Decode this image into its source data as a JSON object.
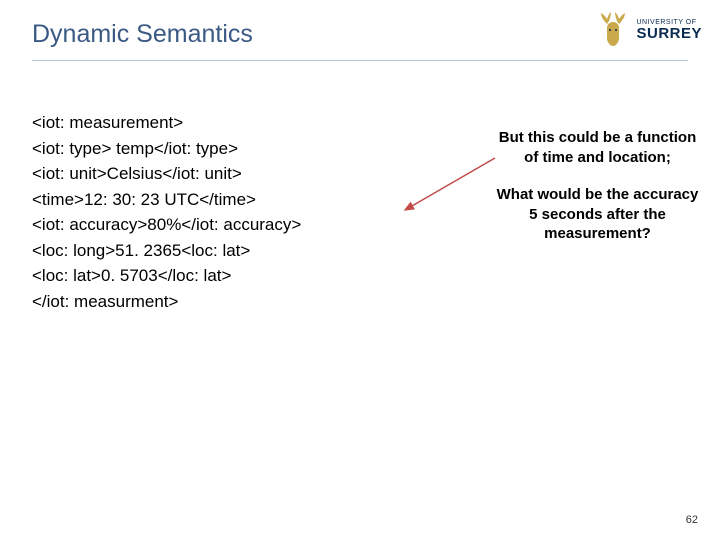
{
  "slide": {
    "title": "Dynamic Semantics",
    "page_number": "62"
  },
  "logo": {
    "university_of": "UNIVERSITY OF",
    "surrey": "SURREY"
  },
  "code": {
    "l1": "<iot: measurement>",
    "l2": "<iot: type> temp</iot: type>",
    "l3": "<iot: unit>Celsius</iot: unit>",
    "l4": "<time>12: 30: 23 UTC</time>",
    "l5": "<iot: accuracy>80%</iot: accuracy>",
    "l6": "<loc: long>51. 2365<loc: lat>",
    "l7": "<loc: lat>0. 5703</loc: lat>",
    "l8": "</iot: measurment>"
  },
  "annotation": {
    "p1": "But this could be a function of time and location;",
    "p2": "What would be the accuracy 5 seconds after the measurement?"
  },
  "colors": {
    "title": "#3a5a84",
    "arrow": "#c24a4a",
    "logo_gold": "#c9a94a",
    "logo_navy": "#0b2a52"
  }
}
